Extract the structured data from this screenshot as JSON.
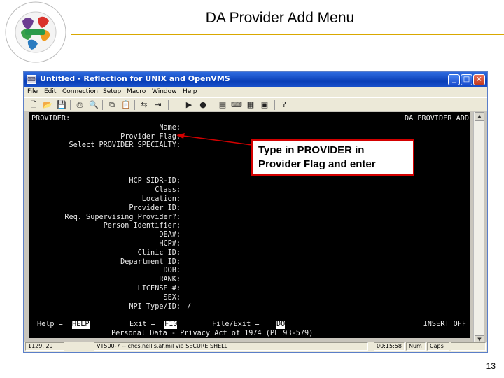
{
  "slide": {
    "title": "DA Provider Add Menu",
    "page_number": "13",
    "logo_icon": "conference-logo",
    "accent_color": "#d9a800"
  },
  "window": {
    "title": "Untitled - Reflection for UNIX and OpenVMS",
    "app_icon": "terminal-app-icon",
    "titlebar_color": "#0a3fb8",
    "buttons": {
      "minimize": "_",
      "maximize": "□",
      "close": "×"
    }
  },
  "menu": [
    "File",
    "Edit",
    "Connection",
    "Setup",
    "Macro",
    "Window",
    "Help"
  ],
  "toolbar_icons": [
    "new-document-icon",
    "open-folder-icon",
    "save-icon",
    "print-icon",
    "find-icon",
    "copy-icon",
    "paste-icon",
    "connect-icon",
    "disconnect-icon",
    "play-icon",
    "record-icon",
    "settings-icon",
    "keyboard-icon",
    "display-icon",
    "help-icon"
  ],
  "terminal": {
    "header_left": "PROVIDER:",
    "header_right": "DA PROVIDER ADD",
    "fields": [
      {
        "label": "Name:",
        "value": ""
      },
      {
        "label": "Provider Flag:",
        "value": ""
      },
      {
        "label": "Select PROVIDER SPECIALTY:",
        "value": ""
      },
      {
        "label": "HCP SIDR-ID:",
        "value": ""
      },
      {
        "label": "Class:",
        "value": ""
      },
      {
        "label": "Location:",
        "value": ""
      },
      {
        "label": "Provider ID:",
        "value": ""
      },
      {
        "label": "Req. Supervising Provider?:",
        "value": ""
      },
      {
        "label": "Person Identifier:",
        "value": ""
      },
      {
        "label": "DEA#:",
        "value": ""
      },
      {
        "label": "HCP#:",
        "value": ""
      },
      {
        "label": "Clinic ID:",
        "value": ""
      },
      {
        "label": "Department ID:",
        "value": ""
      },
      {
        "label": "DOB:",
        "value": ""
      },
      {
        "label": "RANK:",
        "value": ""
      },
      {
        "label": "LICENSE #:",
        "value": ""
      },
      {
        "label": "SEX:",
        "value": ""
      },
      {
        "label": "NPI Type/ID:",
        "value": "/"
      }
    ],
    "footer": {
      "help_label": "Help =",
      "help_key": "HELP",
      "exit_label": "Exit =",
      "exit_key": "F10",
      "fileexit_label": "File/Exit =",
      "fileexit_key": "DO",
      "mode": "INSERT OFF",
      "privacy": "Personal Data - Privacy Act of 1974 (PL 93-579)"
    }
  },
  "statusbar": {
    "cursor": "1129, 29",
    "connection": "VT500-7 -- chcs.nellis.af.mil via SECURE SHELL",
    "time": "00:15:58",
    "num": "Num",
    "caps": "Caps"
  },
  "annotation": {
    "text": "Type in PROVIDER in Provider Flag and enter",
    "border_color": "#d40000"
  }
}
